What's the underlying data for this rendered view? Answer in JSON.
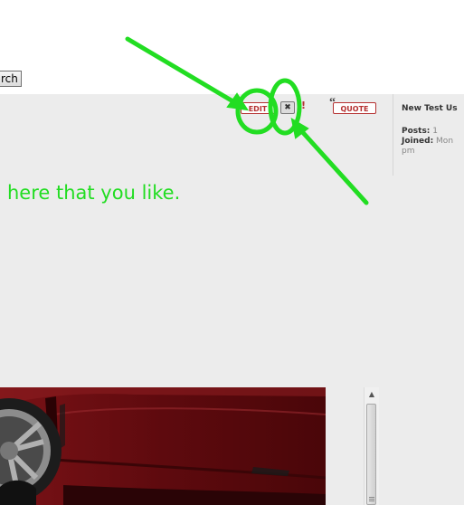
{
  "toolbar": {
    "search_label": "rch"
  },
  "post_buttons": {
    "edit": "EDIT",
    "delete": "✖",
    "report": "!",
    "quote": "QUOTE"
  },
  "profile": {
    "username": "New Test Us",
    "posts_label": "Posts:",
    "posts_value": "1",
    "joined_label": "Joined:",
    "joined_value": "Mon",
    "joined_value2": "pm"
  },
  "post": {
    "text": "n here that you like."
  },
  "colors": {
    "annotation_green": "#22dd22",
    "button_red": "#b43030"
  }
}
